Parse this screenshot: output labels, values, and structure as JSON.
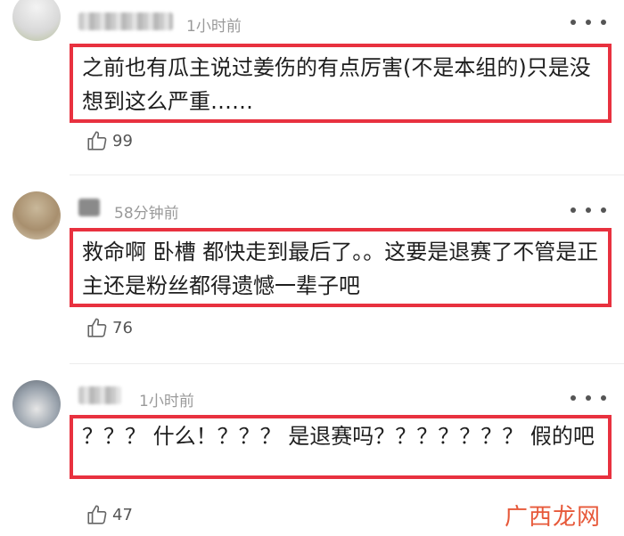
{
  "comments": [
    {
      "time": "1小时前",
      "text": "之前也有瓜主说过姜伤的有点厉害(不是本组的)只是没想到这么严重……",
      "likes": "99"
    },
    {
      "time": "58分钟前",
      "text": "救命啊 卧槽 都快走到最后了。。这要是退赛了不管是正主还是粉丝都得遗憾一辈子吧",
      "likes": "76"
    },
    {
      "time": "1小时前",
      "text": "？？？ 什么！？？？ 是退赛吗？？？？？？？ 假的吧",
      "likes": "47"
    }
  ],
  "watermark": "广西龙网",
  "icons": {
    "like": "thumbs-up-icon",
    "more": "more-dots-icon"
  },
  "colors": {
    "highlight_border": "#e8313f",
    "watermark": "#e7593a"
  }
}
